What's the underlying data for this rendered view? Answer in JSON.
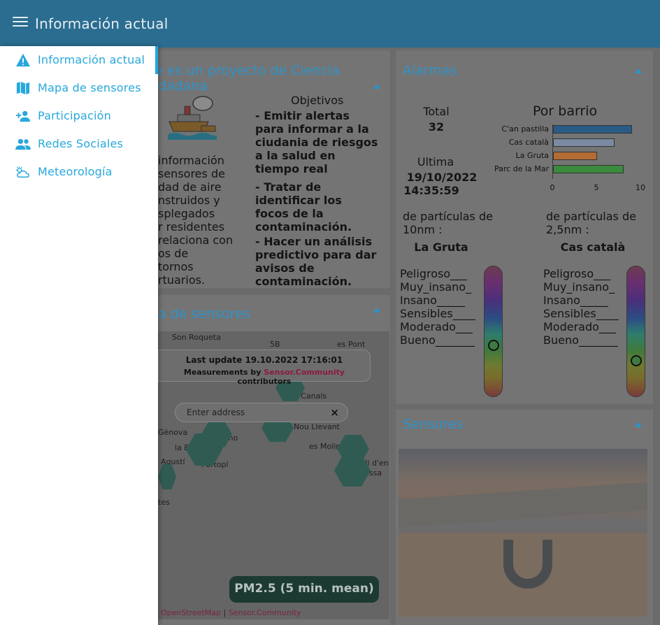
{
  "header": {
    "title": "Información actual"
  },
  "drawer": {
    "items": [
      {
        "label": "Información actual",
        "icon": "warning-icon"
      },
      {
        "label": "Mapa de sensores",
        "icon": "map-icon"
      },
      {
        "label": "Participación",
        "icon": "person-add-icon"
      },
      {
        "label": "Redes Sociales",
        "icon": "people-icon"
      },
      {
        "label": "Meteorología",
        "icon": "partly-cloudy-icon"
      }
    ]
  },
  "project": {
    "title_line1": "te es un proyecto de Ciencia",
    "title_line2": "udadana",
    "desc_lines": [
      "información",
      "sensores de",
      "dad de aire",
      "nstruidos y",
      "splegados",
      "r residentes",
      "relaciona con",
      "os de",
      "tornos",
      "rtuarios."
    ],
    "objectives_title": "Objetivos",
    "objectives": [
      [
        "- Emitir alertas",
        "para informar a la",
        "ciudania de riesgos",
        "a la salud en",
        "tiempo real"
      ],
      [
        "- Tratar de",
        "identificar los",
        "focos de la",
        "contaminación."
      ],
      [
        "- Hacer un análisis",
        "predictivo para dar",
        "avisos de",
        "contaminación."
      ]
    ]
  },
  "map": {
    "title": "pa de sensores",
    "places": [
      "Son Roqueta",
      "5B",
      "es Pont d'Inca",
      "Son Canals",
      "Nou Llevant",
      "Gènova",
      "El Terreno",
      "la Bonanova",
      "es Molinar",
      "Agustí",
      "Portopí",
      "es Coll d'en",
      "Rabassa",
      "tes"
    ],
    "update_label": "Last update 19.10.2022 17:16:01",
    "measure_prefix": "Measurements by ",
    "measure_link": "Sensor.Community",
    "measure_suffix": " contributors",
    "address_placeholder": "Enter address",
    "clear_symbol": "×",
    "pm_label": "PM2.5 (5 min. mean)",
    "attribution_osm": "OpenStreetMap",
    "attribution_sep": " | ",
    "attribution_sc": "Sensor.Community"
  },
  "alarms": {
    "title": "Alarmas",
    "total_label": "Total",
    "total_value": "32",
    "last_label": "Ultima",
    "last_date": "19/10/2022",
    "last_time": "14:35:59",
    "gauge10": {
      "title_line1": "de partículas de",
      "title_line2": "10nm :",
      "station": "La Gruta",
      "level": 0.6
    },
    "gauge25": {
      "title_line1": "de partículas de",
      "title_line2": "2,5nm :",
      "station": "Cas català",
      "level": 0.72
    },
    "levels": [
      "Peligroso___",
      "Muy_insano_",
      "Insano_____",
      "Sensibles____",
      "Moderado___",
      "Bueno_______"
    ]
  },
  "chart_data": {
    "type": "bar",
    "title": "Por barrio",
    "orientation": "horizontal",
    "categories": [
      "C'an pastilla",
      "Cas català",
      "La Gruta",
      "Parc de la Mar"
    ],
    "values": [
      9,
      7,
      5,
      8
    ],
    "colors": [
      "#2a5b86",
      "#7b8aa1",
      "#b36c33",
      "#3b8a3d"
    ],
    "xlim": [
      0,
      10
    ],
    "xticks": [
      0,
      5,
      10
    ],
    "grid": false
  },
  "sensors": {
    "title": "Sensores"
  }
}
